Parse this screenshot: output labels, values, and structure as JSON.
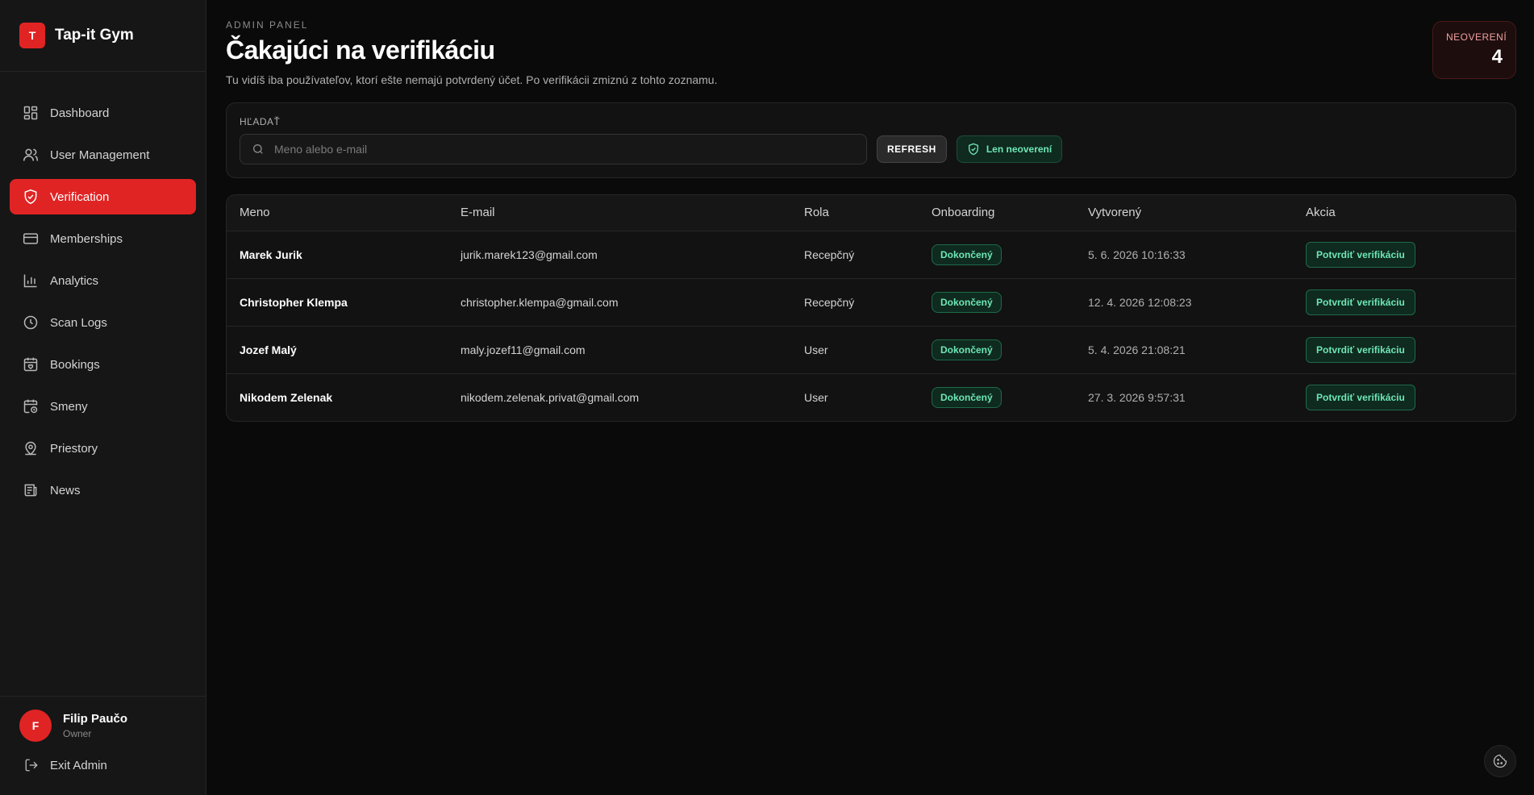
{
  "brand": {
    "logo_letter": "T",
    "name": "Tap-it Gym"
  },
  "sidebar": {
    "items": [
      {
        "label": "Dashboard",
        "icon": "dashboard-icon"
      },
      {
        "label": "User Management",
        "icon": "users-icon"
      },
      {
        "label": "Verification",
        "icon": "shield-check-icon",
        "active": true
      },
      {
        "label": "Memberships",
        "icon": "card-icon"
      },
      {
        "label": "Analytics",
        "icon": "bar-chart-icon"
      },
      {
        "label": "Scan Logs",
        "icon": "clock-icon"
      },
      {
        "label": "Bookings",
        "icon": "calendar-heart-icon"
      },
      {
        "label": "Smeny",
        "icon": "calendar-clock-icon"
      },
      {
        "label": "Priestory",
        "icon": "map-pin-user-icon"
      },
      {
        "label": "News",
        "icon": "newspaper-icon"
      }
    ],
    "user": {
      "initial": "F",
      "name": "Filip Paučo",
      "role": "Owner"
    },
    "exit_label": "Exit Admin"
  },
  "header": {
    "eyebrow": "ADMIN PANEL",
    "title": "Čakajúci na verifikáciu",
    "description": "Tu vidíš iba používateľov, ktorí ešte nemajú potvrdený účet. Po verifikácii zmiznú z tohto zoznamu."
  },
  "counter": {
    "label": "NEOVERENÍ",
    "value": "4"
  },
  "filters": {
    "search_label": "HĽADAŤ",
    "search_placeholder": "Meno alebo e-mail",
    "search_value": "",
    "refresh_label": "REFRESH",
    "only_unverified_label": "Len neoverení"
  },
  "table": {
    "columns": [
      "Meno",
      "E-mail",
      "Rola",
      "Onboarding",
      "Vytvorený",
      "Akcia"
    ],
    "rows": [
      {
        "name": "Marek Jurik",
        "email": "jurik.marek123@gmail.com",
        "role": "Recepčný",
        "onboarding": "Dokončený",
        "created": "5. 6. 2026 10:16:33",
        "action": "Potvrdiť verifikáciu"
      },
      {
        "name": "Christopher Klempa",
        "email": "christopher.klempa@gmail.com",
        "role": "Recepčný",
        "onboarding": "Dokončený",
        "created": "12. 4. 2026 12:08:23",
        "action": "Potvrdiť verifikáciu"
      },
      {
        "name": "Jozef Malý",
        "email": "maly.jozef11@gmail.com",
        "role": "User",
        "onboarding": "Dokončený",
        "created": "5. 4. 2026 21:08:21",
        "action": "Potvrdiť verifikáciu"
      },
      {
        "name": "Nikodem Zelenak",
        "email": "nikodem.zelenak.privat@gmail.com",
        "role": "User",
        "onboarding": "Dokončený",
        "created": "27. 3. 2026 9:57:31",
        "action": "Potvrdiť verifikáciu"
      }
    ]
  },
  "colors": {
    "accent": "#e02424",
    "success": "#6ee7b7",
    "background": "#0a0a0a",
    "panel": "#161616"
  }
}
